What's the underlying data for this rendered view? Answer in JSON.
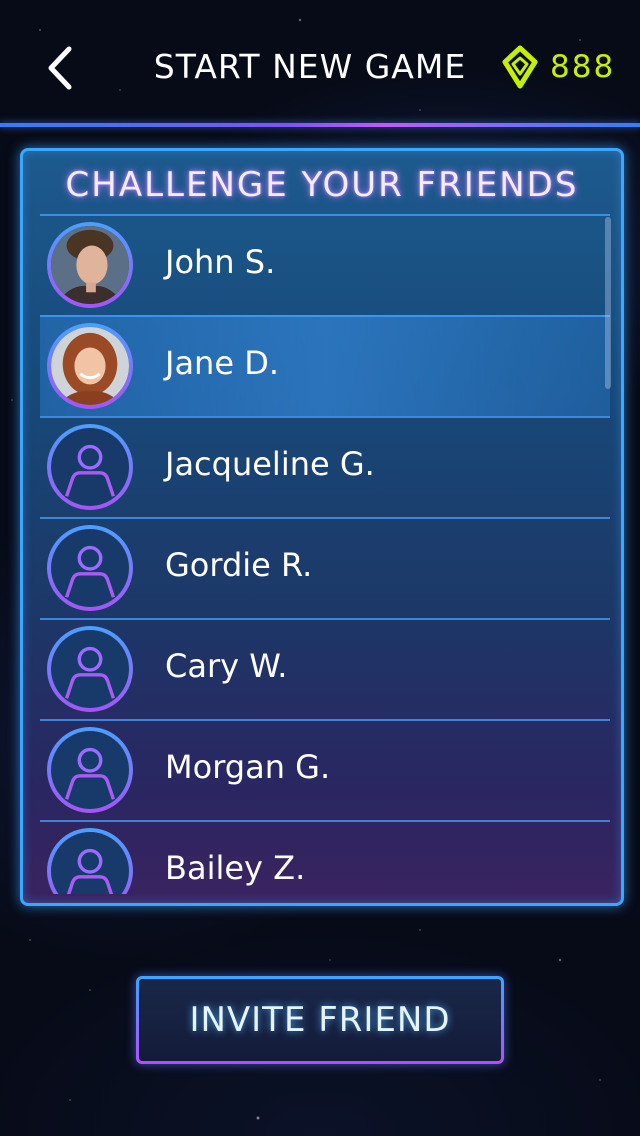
{
  "header": {
    "back_icon": "chevron-left-icon",
    "title": "START NEW GAME",
    "gem_icon": "gem-icon",
    "gem_count": "888"
  },
  "friends_panel": {
    "title": "CHALLENGE YOUR FRIENDS",
    "friends": [
      {
        "name": "John S.",
        "avatar": "photo",
        "selected": false
      },
      {
        "name": "Jane D.",
        "avatar": "photo",
        "selected": true
      },
      {
        "name": "Jacqueline G.",
        "avatar": "user-icon",
        "selected": false
      },
      {
        "name": "Gordie R.",
        "avatar": "user-icon",
        "selected": false
      },
      {
        "name": "Cary W.",
        "avatar": "user-icon",
        "selected": false
      },
      {
        "name": "Morgan G.",
        "avatar": "user-icon",
        "selected": false
      },
      {
        "name": "Bailey Z.",
        "avatar": "user-icon",
        "selected": false
      }
    ]
  },
  "invite_button": {
    "label": "INVITE FRIEND"
  },
  "colors": {
    "accent": "#3aa8ff",
    "secondary_accent": "#a455f5",
    "gem": "#c6f000",
    "text": "#ffffff"
  }
}
